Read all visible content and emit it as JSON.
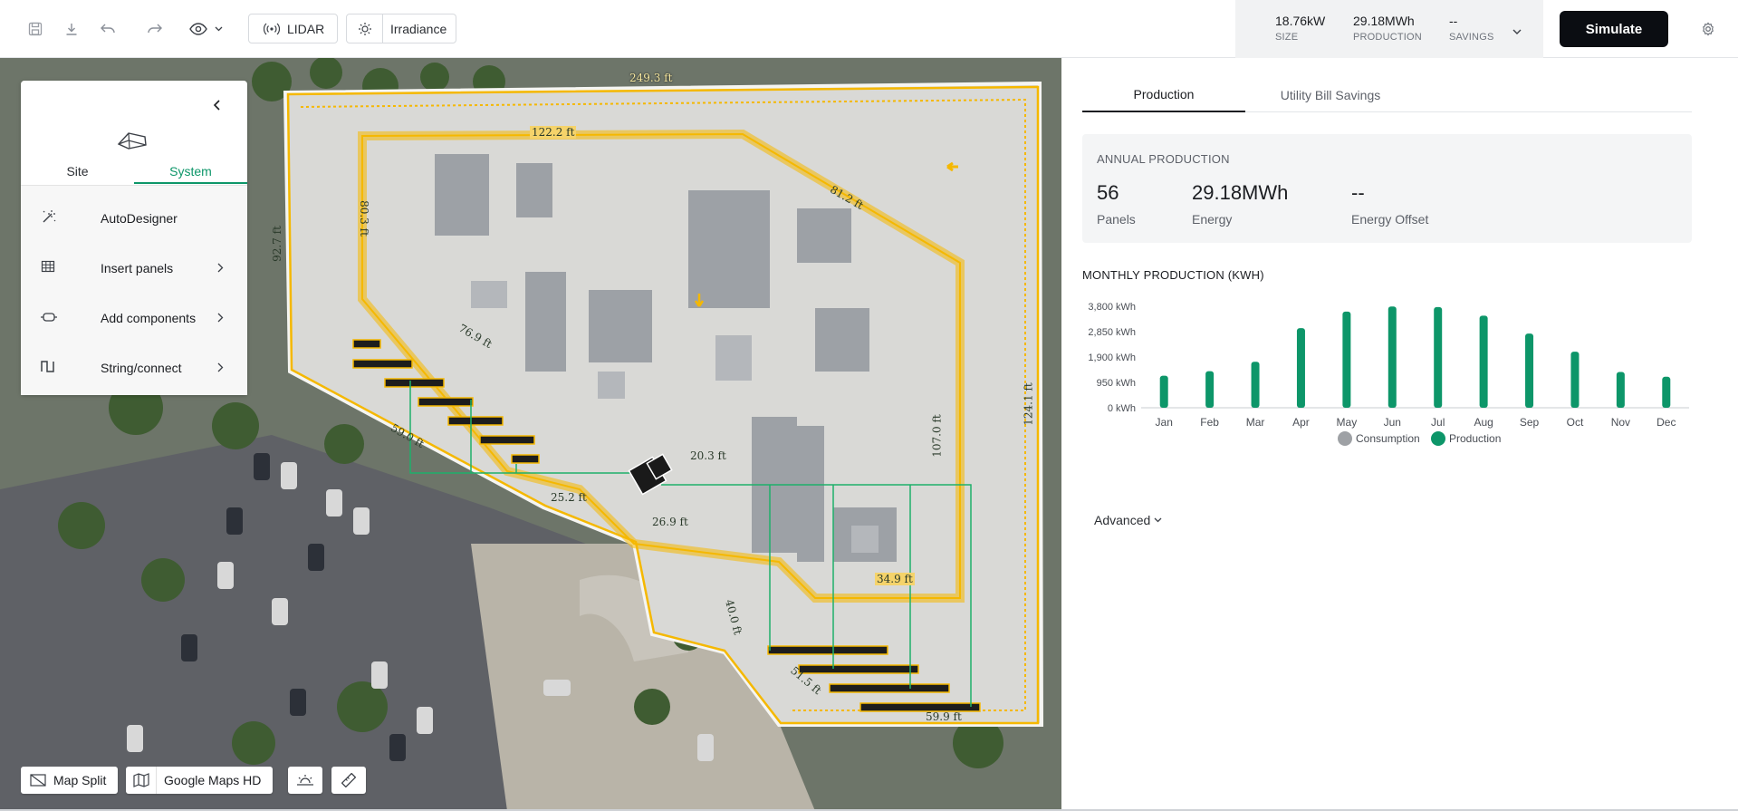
{
  "toolbar": {
    "lidar_label": "LIDAR",
    "irradiance_label": "Irradiance"
  },
  "summary": {
    "size_value": "18.76kW",
    "size_label": "SIZE",
    "production_value": "29.18MWh",
    "production_label": "PRODUCTION",
    "savings_value": "--",
    "savings_label": "SAVINGS",
    "simulate_label": "Simulate"
  },
  "design_panel": {
    "tabs": [
      "Site",
      "System"
    ],
    "active_tab": "System",
    "items": [
      {
        "label": "AutoDesigner",
        "icon": "magic-wand-icon",
        "has_submenu": false
      },
      {
        "label": "Insert panels",
        "icon": "grid-icon",
        "has_submenu": true
      },
      {
        "label": "Add components",
        "icon": "component-icon",
        "has_submenu": true
      },
      {
        "label": "String/connect",
        "icon": "string-icon",
        "has_submenu": true
      }
    ]
  },
  "map": {
    "measurements": [
      "249.3 ft",
      "122.2 ft",
      "81.2 ft",
      "80.3 ft",
      "92.7 ft",
      "76.9 ft",
      "59.0 ft",
      "20.3 ft",
      "25.2 ft",
      "107.0 ft",
      "124.1 ft",
      "34.9 ft",
      "26.9 ft",
      "40.0 ft",
      "51.5 ft",
      "59.9 ft"
    ],
    "buttons": {
      "map_split": "Map Split",
      "google_maps": "Google Maps HD"
    }
  },
  "right_panel": {
    "tabs": [
      "Production",
      "Utility Bill Savings"
    ],
    "active_tab": "Production",
    "annual": {
      "title": "ANNUAL PRODUCTION",
      "panels_value": "56",
      "panels_label": "Panels",
      "energy_value": "29.18MWh",
      "energy_label": "Energy",
      "offset_value": "--",
      "offset_label": "Energy Offset"
    },
    "monthly_title": "MONTHLY PRODUCTION (KWH)",
    "advanced_label": "Advanced"
  },
  "colors": {
    "production": "#0d9669",
    "consumption": "#9ea1a5",
    "setback": "#f5b800",
    "string": "#1fb06a"
  },
  "chart_data": {
    "type": "bar",
    "categories": [
      "Jan",
      "Feb",
      "Mar",
      "Apr",
      "May",
      "Jun",
      "Jul",
      "Aug",
      "Sep",
      "Oct",
      "Nov",
      "Dec"
    ],
    "series": [
      {
        "name": "Consumption",
        "values": [
          0,
          0,
          0,
          0,
          0,
          0,
          0,
          0,
          0,
          0,
          0,
          0
        ]
      },
      {
        "name": "Production",
        "values": [
          1200,
          1370,
          1720,
          2980,
          3600,
          3790,
          3770,
          3450,
          2780,
          2100,
          1340,
          1160
        ]
      }
    ],
    "yticks": [
      "0 kWh",
      "950 kWh",
      "1,900 kWh",
      "2,850 kWh",
      "3,800 kWh"
    ],
    "ylim": [
      0,
      3800
    ],
    "legend": "bottom-center",
    "grid": false
  }
}
